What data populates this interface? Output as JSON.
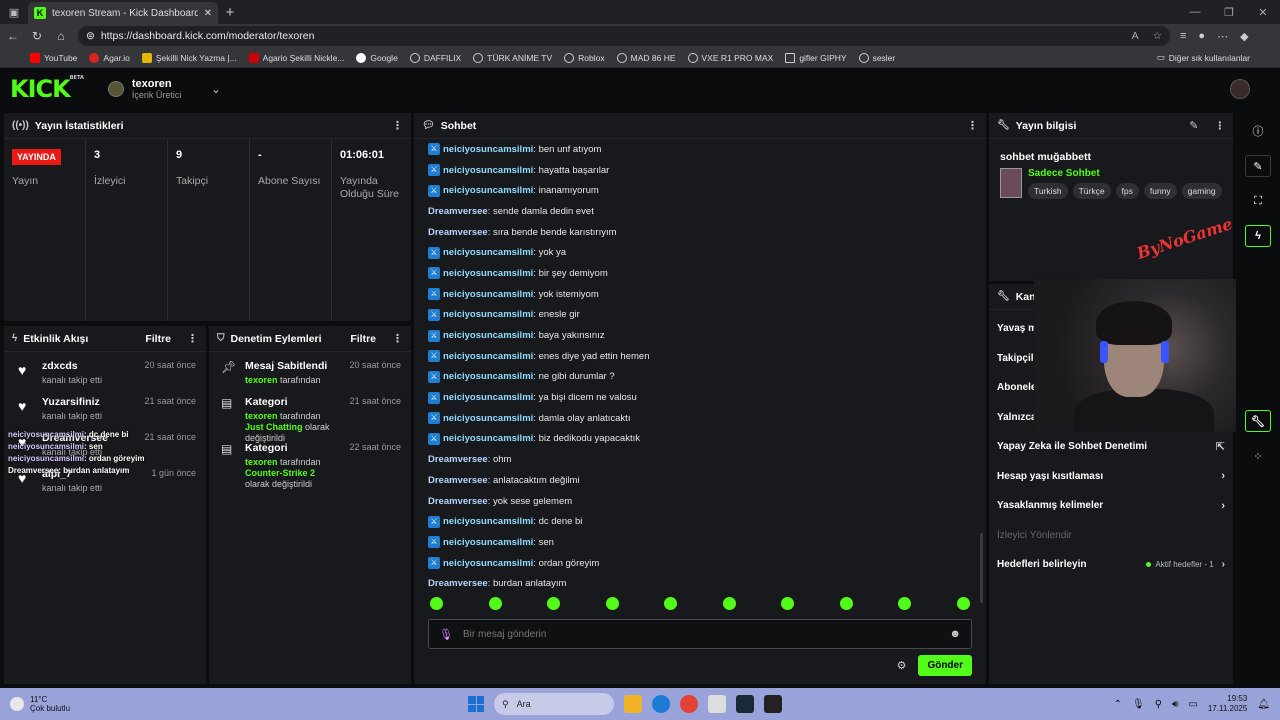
{
  "browser": {
    "tab_title": "texoren Stream - Kick Dashboard",
    "url": "https://dashboard.kick.com/moderator/texoren",
    "bookmarks": [
      "YouTube",
      "Agar.io",
      "Şekilli Nick Yazma |...",
      "Agario Şekilli Nickle...",
      "Google",
      "DAFFILIX",
      "TÜRK ANİME TV",
      "Roblox",
      "MAD 86 HE",
      "VXE R1 PRO MAX",
      "gifler GIPHY",
      "sesler"
    ],
    "other_bookmarks": "Diğer sık kullanılanlar"
  },
  "header": {
    "logo": "KICK",
    "logo_beta": "BETA",
    "channel_name": "texoren",
    "channel_role": "İçerik Üretici"
  },
  "stats": {
    "title": "Yayın İstatistikleri",
    "live_badge": "YAYINDA",
    "items": [
      {
        "value": "",
        "label": "Yayın"
      },
      {
        "value": "3",
        "label": "İzleyici"
      },
      {
        "value": "9",
        "label": "Takipçi"
      },
      {
        "value": "-",
        "label": "Abone Sayısı"
      },
      {
        "value": "01:06:01",
        "label": "Yayında Olduğu Süre"
      }
    ]
  },
  "activity": {
    "title": "Etkinlik Akışı",
    "filter": "Filtre",
    "items": [
      {
        "name": "zdxcds",
        "sub": "kanalı takip etti",
        "time": "20 saat önce"
      },
      {
        "name": "Yuzarsifiniz",
        "sub": "kanalı takip etti",
        "time": "21 saat önce"
      },
      {
        "name": "Dreamversee",
        "sub": "kanalı takip etti",
        "time": "21 saat önce"
      },
      {
        "name": "alpi_7",
        "sub": "kanalı takip etti",
        "time": "1 gün önce"
      }
    ],
    "overlay": [
      {
        "user": "neiciyosuncamsilmi",
        "text": "dc dene bi"
      },
      {
        "user": "neiciyosuncamsilmi",
        "text": "sen"
      },
      {
        "user": "neiciyosuncamsilmi",
        "text": "ordan göreyim"
      },
      {
        "user": "Dreamversee",
        "text": "burdan anlatayım"
      }
    ]
  },
  "moderation": {
    "title": "Denetim Eylemleri",
    "filter": "Filtre",
    "items": [
      {
        "title": "Mesaj Sabitlendi",
        "user": "texoren",
        "pre": "",
        "mid": " tarafından",
        "cat": "",
        "post": "",
        "time": "20 saat önce"
      },
      {
        "title": "Kategori",
        "user": "texoren",
        "pre": "",
        "mid": " tarafından ",
        "cat": "Just Chatting",
        "post": " olarak değiştirildi",
        "time": "21 saat önce"
      },
      {
        "title": "Kategori",
        "user": "texoren",
        "pre": "",
        "mid": " tarafından ",
        "cat": "Counter-Strike 2",
        "post": " olarak değiştirildi",
        "time": "22 saat önce"
      }
    ]
  },
  "chat": {
    "title": "Sohbet",
    "messages": [
      {
        "user": "neiciyosuncamsilmi",
        "text": "ben unf atıyom",
        "badge": true
      },
      {
        "user": "neiciyosuncamsilmi",
        "text": "hayatta başarılar",
        "badge": true
      },
      {
        "user": "neiciyosuncamsilmi",
        "text": "inanamıyorum",
        "badge": true
      },
      {
        "user": "Dreamversee",
        "text": "sende damla dedin evet",
        "badge": false
      },
      {
        "user": "Dreamversee",
        "text": "sıra bende bende karıstırıyım",
        "badge": false
      },
      {
        "user": "neiciyosuncamsilmi",
        "text": "yok ya",
        "badge": true
      },
      {
        "user": "neiciyosuncamsilmi",
        "text": "bir şey demiyom",
        "badge": true
      },
      {
        "user": "neiciyosuncamsilmi",
        "text": "yok istemiyom",
        "badge": true
      },
      {
        "user": "neiciyosuncamsilmi",
        "text": "enesle gir",
        "badge": true
      },
      {
        "user": "neiciyosuncamsilmi",
        "text": "baya yakınsınız",
        "badge": true
      },
      {
        "user": "neiciyosuncamsilmi",
        "text": "enes diye yad ettin hemen",
        "badge": true
      },
      {
        "user": "neiciyosuncamsilmi",
        "text": "ne gibi durumlar ?",
        "badge": true
      },
      {
        "user": "neiciyosuncamsilmi",
        "text": "ya bişi dicem ne valosu",
        "badge": true
      },
      {
        "user": "neiciyosuncamsilmi",
        "text": "damla olay anlatıcaktı",
        "badge": true
      },
      {
        "user": "neiciyosuncamsilmi",
        "text": "biz dedikodu yapacaktık",
        "badge": true
      },
      {
        "user": "Dreamversee",
        "text": "ohm",
        "badge": false
      },
      {
        "user": "Dreamversee",
        "text": "anlatacaktım değilmi",
        "badge": false
      },
      {
        "user": "Dreamversee",
        "text": "yok sese gelemem",
        "badge": false
      },
      {
        "user": "neiciyosuncamsilmi",
        "text": "dc dene bi",
        "badge": true
      },
      {
        "user": "neiciyosuncamsilmi",
        "text": "sen",
        "badge": true
      },
      {
        "user": "neiciyosuncamsilmi",
        "text": "ordan göreyim",
        "badge": true
      },
      {
        "user": "Dreamversee",
        "text": "burdan anlatayım",
        "badge": false
      }
    ],
    "input_placeholder": "Bir mesaj gönderin",
    "send_label": "Gönder",
    "emote_count": 10
  },
  "stream_info": {
    "title": "Yayın bilgisi",
    "stream_title": "sohbet muğabbett",
    "category": "Sadece Sohbet",
    "tags": [
      "Turkish",
      "Türkçe",
      "fps",
      "funny",
      "gaming"
    ],
    "signature": "ByNoGame"
  },
  "chat_settings": {
    "title": "Kanal",
    "rows": [
      {
        "label": "Yavaş m",
        "chev": ""
      },
      {
        "label": "Takipçil",
        "chev": ""
      },
      {
        "label": "Abonele",
        "chev": ""
      },
      {
        "label": "Yalnızca",
        "chev": ""
      },
      {
        "label": "Yapay Zeka ile Sohbet Denetimi",
        "chev": "⇱"
      },
      {
        "label": "Hesap yaşı kısıtlaması",
        "chev": "›"
      },
      {
        "label": "Yasaklanmış kelimeler",
        "chev": "›"
      }
    ],
    "section_label": "İzleyici Yönlendir",
    "targets_label": "Hedefleri belirleyin",
    "active_targets": "Aktif hedefler - 1"
  },
  "taskbar": {
    "temp": "11°C",
    "weather": "Çok bulutlu",
    "search": "Ara",
    "time": "19:53",
    "date": "17.11.2025",
    "notif_count": "9+"
  },
  "colors": {
    "accent": "#53fc18",
    "live": "#e91916",
    "taskbar": "#9aa3d9"
  }
}
